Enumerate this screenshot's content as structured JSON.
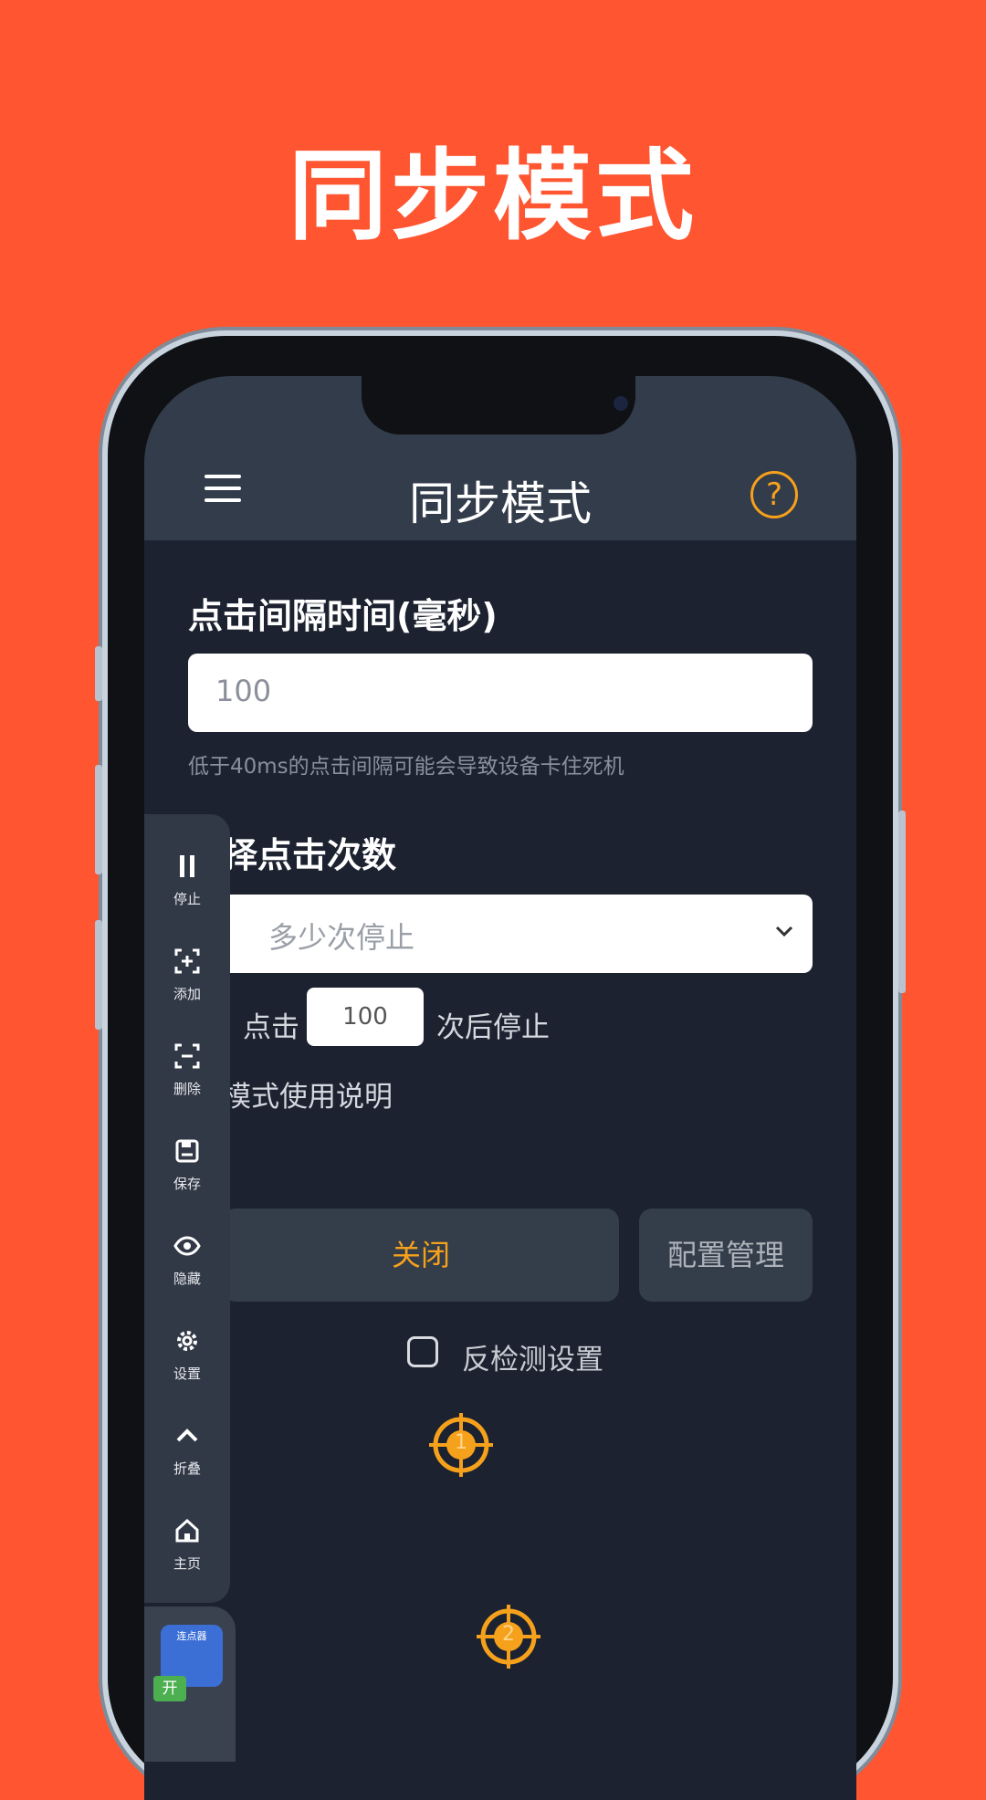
{
  "hero": {
    "title": "同步模式"
  },
  "appbar": {
    "title": "同步模式",
    "help_symbol": "?"
  },
  "interval": {
    "label": "点击间隔时间(毫秒)",
    "value": "100",
    "hint": "低于40ms的点击间隔可能会导致设备卡住死机"
  },
  "count": {
    "label": "择点击次数",
    "dropdown_value": "多少次停止",
    "prefix": "点击",
    "value": "100",
    "suffix": "次后停止"
  },
  "instructions": "模式使用说明",
  "buttons": {
    "close": "关闭",
    "config": "配置管理"
  },
  "anti_detect": {
    "label": "反检测设置",
    "checked": false
  },
  "targets": [
    "1",
    "2"
  ],
  "toolbar": {
    "items": [
      {
        "label": "停止",
        "icon": "pause-icon"
      },
      {
        "label": "添加",
        "icon": "add-target-icon"
      },
      {
        "label": "删除",
        "icon": "remove-target-icon"
      },
      {
        "label": "保存",
        "icon": "save-icon"
      },
      {
        "label": "隐藏",
        "icon": "eye-icon"
      },
      {
        "label": "设置",
        "icon": "gear-icon"
      },
      {
        "label": "折叠",
        "icon": "chevron-up-icon"
      },
      {
        "label": "主页",
        "icon": "home-icon"
      }
    ]
  },
  "widget": {
    "app_label": "连点器",
    "badge": "开"
  },
  "colors": {
    "background": "#ff5530",
    "accent": "#f6a11c",
    "screen": "#1c2230",
    "appbar": "#333c4a"
  }
}
